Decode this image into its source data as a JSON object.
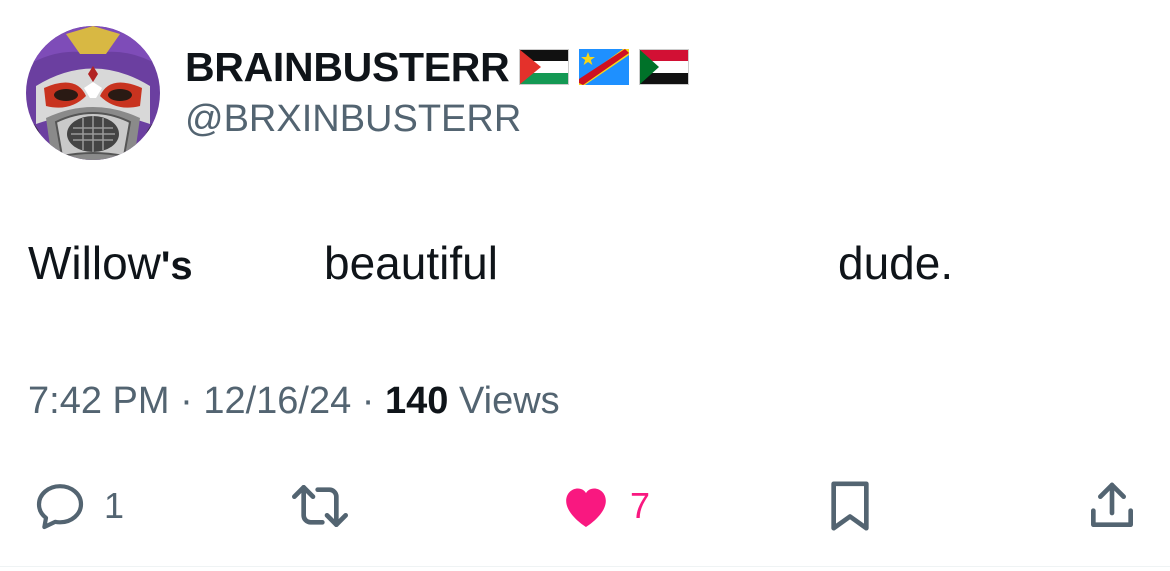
{
  "author": {
    "display_name": "BRAINBUSTERR",
    "handle": "@BRXINBUSTERR",
    "flags": [
      "palestine-flag",
      "dr-congo-flag",
      "sudan-flag"
    ]
  },
  "tweet": {
    "word1": "Willow",
    "word1_suffix": "'s",
    "word2": "beautiful",
    "word3": "dude."
  },
  "meta": {
    "time": "7:42 PM",
    "separator": "·",
    "date": "12/16/24",
    "views_count": "140",
    "views_label": "Views"
  },
  "actions": {
    "reply_count": "1",
    "like_count": "7"
  },
  "colors": {
    "text": "#0f1419",
    "secondary": "#536471",
    "like": "#f91880",
    "divider": "#eff3f4"
  },
  "icons": [
    "reply-icon",
    "retweet-icon",
    "heart-icon",
    "bookmark-icon",
    "share-icon"
  ]
}
